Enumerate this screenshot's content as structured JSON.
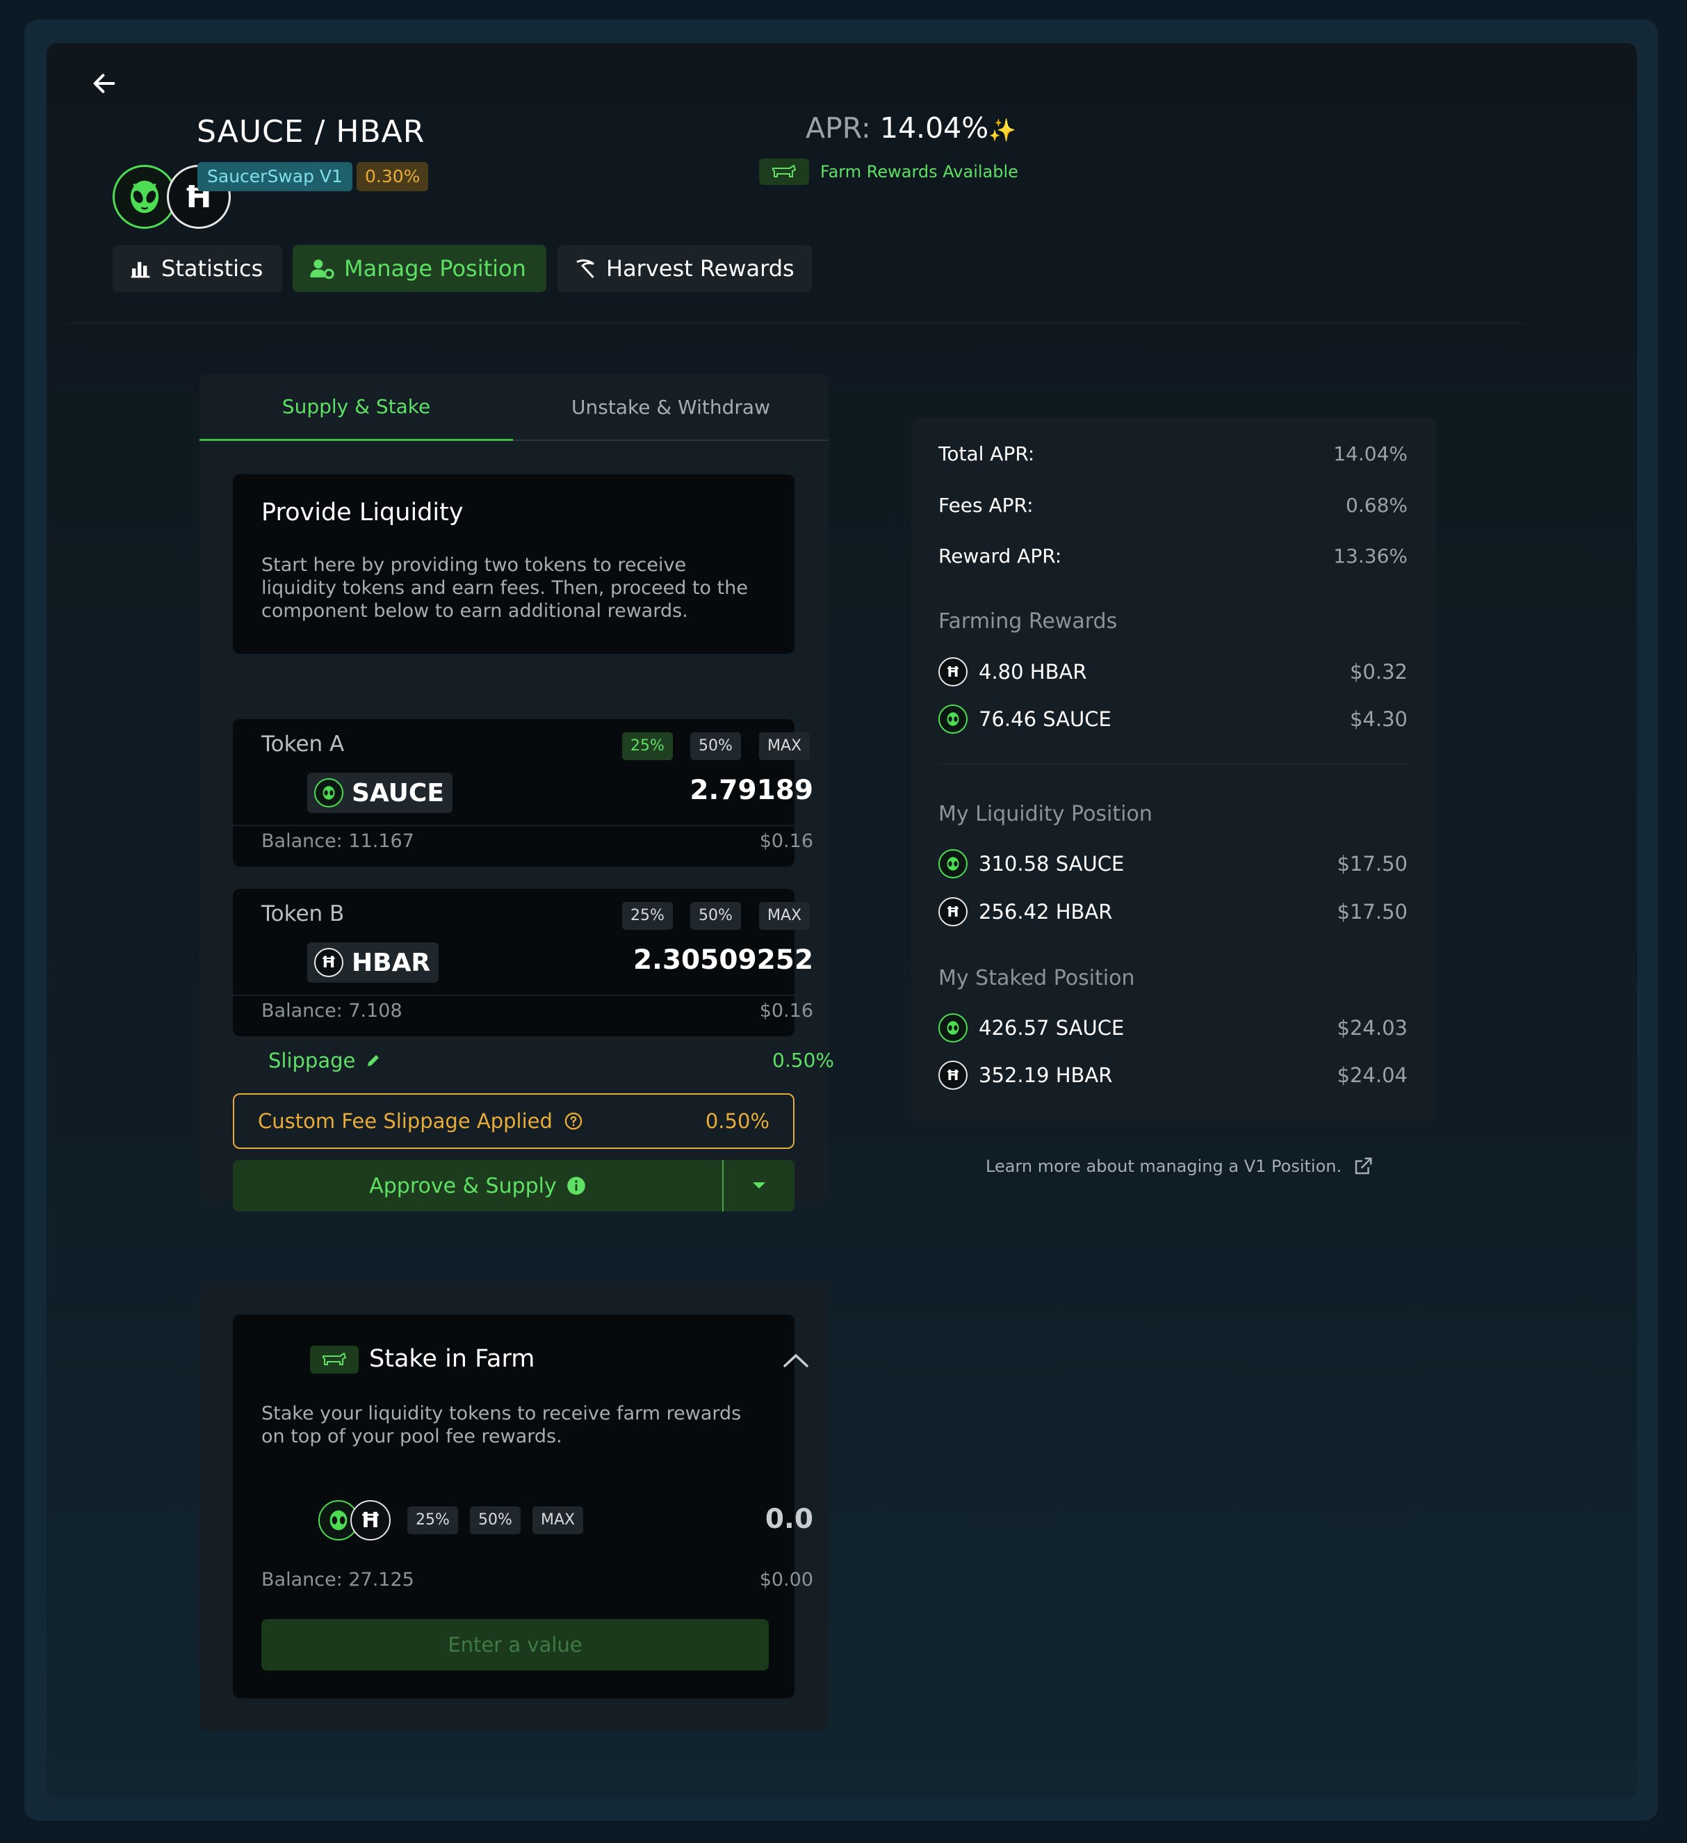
{
  "header": {
    "pair_title": "SAUCE / HBAR",
    "protocol_badge": "SaucerSwap V1",
    "fee_badge": "0.30%",
    "apr_label": "APR:",
    "apr_value": "14.04%",
    "apr_sparkle": "✨",
    "farm_rewards_text": "Farm Rewards Available"
  },
  "nav_tabs": [
    {
      "label": "Statistics",
      "icon": "bar-chart-icon",
      "active": false
    },
    {
      "label": "Manage Position",
      "icon": "user-gear-icon",
      "active": true
    },
    {
      "label": "Harvest Rewards",
      "icon": "scythe-icon",
      "active": false
    }
  ],
  "sub_tabs": [
    {
      "label": "Supply & Stake",
      "active": true
    },
    {
      "label": "Unstake & Withdraw",
      "active": false
    }
  ],
  "provide": {
    "title": "Provide Liquidity",
    "description": "Start here by providing two tokens to receive liquidity tokens and earn fees. Then, proceed to the component below to earn additional rewards."
  },
  "token_a": {
    "label": "Token A",
    "symbol": "SAUCE",
    "amount": "2.79189",
    "balance": "Balance: 11.167",
    "usd": "$0.16",
    "pct_buttons": [
      "25%",
      "50%",
      "MAX"
    ],
    "active_pct": "25%"
  },
  "token_b": {
    "label": "Token B",
    "symbol": "HBAR",
    "amount": "2.30509252",
    "balance": "Balance: 7.108",
    "usd": "$0.16",
    "pct_buttons": [
      "25%",
      "50%",
      "MAX"
    ]
  },
  "slippage": {
    "label": "Slippage",
    "value": "0.50%"
  },
  "custom_fee": {
    "label": "Custom Fee Slippage Applied",
    "value": "0.50%"
  },
  "approve_button": "Approve & Supply",
  "stake": {
    "title": "Stake in Farm",
    "description": "Stake your liquidity tokens to receive farm rewards on top of your pool fee rewards.",
    "pct_buttons": [
      "25%",
      "50%",
      "MAX"
    ],
    "amount": "0.0",
    "balance": "Balance: 27.125",
    "usd": "$0.00",
    "button": "Enter a value"
  },
  "summary": {
    "rows": [
      {
        "label": "Total APR:",
        "value": "14.04%"
      },
      {
        "label": "Fees APR:",
        "value": "0.68%"
      },
      {
        "label": "Reward APR:",
        "value": "13.36%"
      }
    ],
    "farming_title": "Farming Rewards",
    "farming": [
      {
        "token": "HBAR",
        "amount": "4.80 HBAR",
        "usd": "$0.32"
      },
      {
        "token": "SAUCE",
        "amount": "76.46 SAUCE",
        "usd": "$4.30"
      }
    ],
    "liquidity_title": "My Liquidity Position",
    "liquidity": [
      {
        "token": "SAUCE",
        "amount": "310.58 SAUCE",
        "usd": "$17.50"
      },
      {
        "token": "HBAR",
        "amount": "256.42 HBAR",
        "usd": "$17.50"
      }
    ],
    "staked_title": "My Staked Position",
    "staked": [
      {
        "token": "SAUCE",
        "amount": "426.57 SAUCE",
        "usd": "$24.03"
      },
      {
        "token": "HBAR",
        "amount": "352.19 HBAR",
        "usd": "$24.04"
      }
    ]
  },
  "learn_more": "Learn more about managing a V1 Position.",
  "colors": {
    "accent_green": "#5de063",
    "warning_orange": "#e8ac3a",
    "badge_teal": "#7fe0ec"
  }
}
